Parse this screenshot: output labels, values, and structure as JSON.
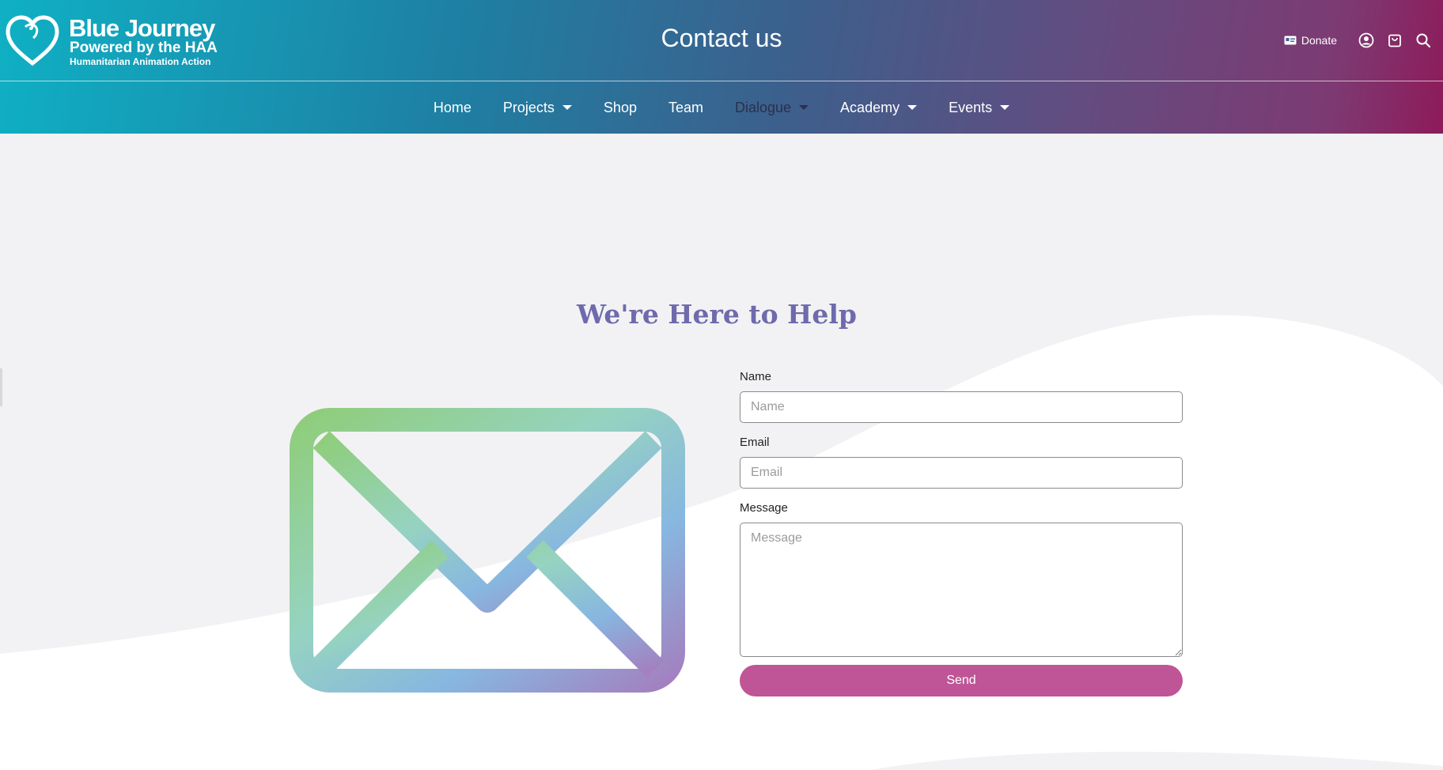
{
  "brand": {
    "name": "Blue Journey",
    "tagline": "Powered by the HAA",
    "subtagline": "Humanitarian Animation Action"
  },
  "header": {
    "page_title": "Contact us"
  },
  "utility": {
    "donate_label": "Donate",
    "icons": [
      "donate-card-icon",
      "user-account-icon",
      "shopping-bag-icon",
      "search-icon"
    ]
  },
  "nav": {
    "items": [
      {
        "label": "Home",
        "dropdown": false
      },
      {
        "label": "Projects",
        "dropdown": true
      },
      {
        "label": "Shop",
        "dropdown": false
      },
      {
        "label": "Team",
        "dropdown": false
      },
      {
        "label": "Dialogue",
        "dropdown": true,
        "active": true
      },
      {
        "label": "Academy",
        "dropdown": true
      },
      {
        "label": "Events",
        "dropdown": true
      }
    ]
  },
  "main": {
    "title": "We're Here to Help",
    "illustration": "envelope-icon"
  },
  "form": {
    "name_label": "Name",
    "name_placeholder": "Name",
    "name_value": "",
    "email_label": "Email",
    "email_placeholder": "Email",
    "email_value": "",
    "message_label": "Message",
    "message_placeholder": "Message",
    "message_value": "",
    "send_label": "Send"
  },
  "colors": {
    "header_gradient_start": "#0fb0c4",
    "header_gradient_end": "#8e1a5a",
    "title_color": "#6e6aac",
    "send_button": "#bf5596",
    "background": "#f2f2f4"
  }
}
